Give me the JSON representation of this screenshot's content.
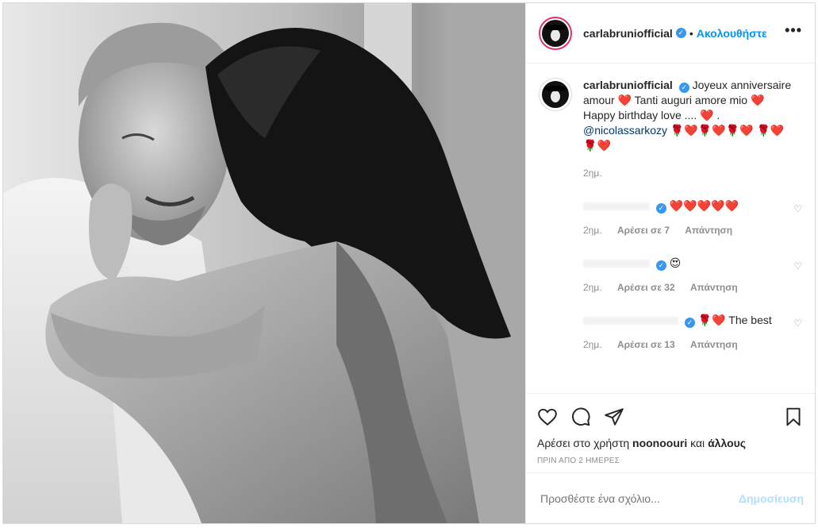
{
  "header": {
    "username": "carlabruniofficial",
    "separator": "•",
    "follow_label": "Ακολουθήστε",
    "more_label": "•••"
  },
  "caption": {
    "username": "carlabruniofficial",
    "text_1": "Joyeux anniversaire amour",
    "text_2": "Tanti auguri amore mio",
    "text_3": "Happy birthday love ....",
    "text_4": ".",
    "mention": "@nicolassarkozy",
    "time": "2ημ."
  },
  "comments": [
    {
      "time": "2ημ.",
      "likes": "Αρέσει σε 7",
      "reply": "Απάντηση"
    },
    {
      "time": "2ημ.",
      "likes": "Αρέσει σε 32",
      "reply": "Απάντηση"
    },
    {
      "text": "The best",
      "time": "2ημ.",
      "likes": "Αρέσει σε 13",
      "reply": "Απάντηση"
    }
  ],
  "likes_line": {
    "prefix": "Αρέσει στο χρήστη",
    "user": "noonoouri",
    "connector": "και",
    "others": "άλλους"
  },
  "timestamp": "ΠΡΙΝ ΑΠΟ 2 ΗΜΕΡΕΣ",
  "add_comment": {
    "placeholder": "Προσθέστε ένα σχόλιο...",
    "post_label": "Δημοσίευση"
  },
  "icons": [
    "heart-icon",
    "comment-icon",
    "share-icon",
    "bookmark-icon",
    "verified-icon",
    "more-icon"
  ],
  "colors": {
    "accent": "#0095f6",
    "verified": "#3897f0",
    "heart": "#e0102a",
    "post_disabled": "#b2dffc"
  }
}
